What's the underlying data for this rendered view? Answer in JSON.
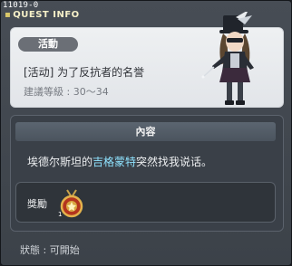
{
  "header": {
    "quest_id": "11019-0",
    "title": "QUEST INFO"
  },
  "quest": {
    "tag": "活動",
    "name": "[活动] 为了反抗者的名誉",
    "level": "建議等級 : 30～34"
  },
  "content": {
    "header": "內容",
    "text_before": "埃德尔斯坦的",
    "npc_name": "吉格蒙特",
    "text_after": "突然找我说话。"
  },
  "reward": {
    "label": "獎勵",
    "item_icon": "medal-icon"
  },
  "status": {
    "label": "狀態 : 可開始"
  },
  "colors": {
    "title": "#f6f0c8",
    "npc_highlight": "#8fe3ff",
    "tag_bg": "#6b6f76"
  }
}
